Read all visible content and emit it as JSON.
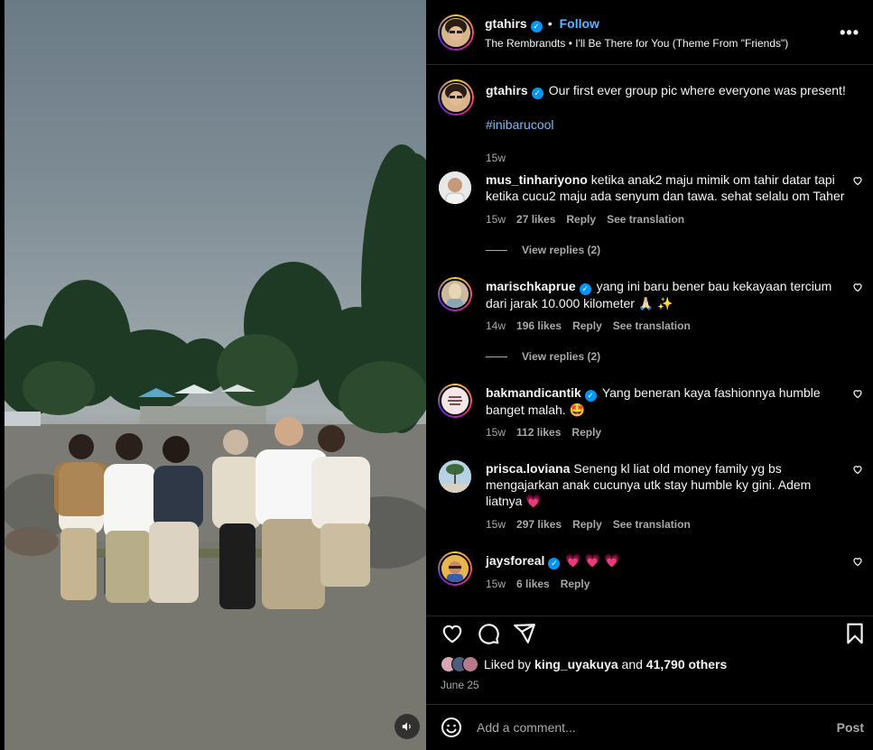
{
  "header": {
    "username": "gtahirs",
    "follow_label": "Follow",
    "separator": "•",
    "audio": "The Rembrandts • I'll Be There for You (Theme From \"Friends\")",
    "more": "•••"
  },
  "caption": {
    "username": "gtahirs",
    "text": "Our first ever group pic where everyone was present!",
    "hashtag": "#inibarucool",
    "time": "15w"
  },
  "comments": [
    {
      "username": "mus_tinhariyono",
      "verified": false,
      "text": "ketika anak2 maju mimik om tahir datar tapi ketika cucu2 maju ada senyum dan tawa. sehat selalu om Taher",
      "time": "15w",
      "likes": "27 likes",
      "reply": "Reply",
      "translation": "See translation",
      "view_replies": "View replies (2)"
    },
    {
      "username": "marischkaprue",
      "verified": true,
      "text": "yang ini baru bener bau kekayaan tercium dari jarak 10.000 kilometer 🙏🏻 ✨",
      "time": "14w",
      "likes": "196 likes",
      "reply": "Reply",
      "translation": "See translation",
      "view_replies": "View replies (2)"
    },
    {
      "username": "bakmandicantik",
      "verified": true,
      "text": "Yang beneran kaya fashionnya humble banget malah. 🤩",
      "time": "15w",
      "likes": "112 likes",
      "reply": "Reply"
    },
    {
      "username": "prisca.loviana",
      "verified": false,
      "text": "Seneng kl liat old money family yg bs mengajarkan anak cucunya utk stay humble ky gini. Adem liatnya 💗",
      "time": "15w",
      "likes": "297 likes",
      "reply": "Reply",
      "translation": "See translation"
    },
    {
      "username": "jaysforeal",
      "verified": true,
      "text": "💗 💗 💗",
      "time": "15w",
      "likes": "6 likes",
      "reply": "Reply"
    }
  ],
  "likes": {
    "prefix": "Liked by",
    "user": "king_uyakuya",
    "middle": "and",
    "count": "41,790 others"
  },
  "date": "June 25",
  "add_comment": {
    "placeholder": "Add a comment...",
    "post_label": "Post"
  },
  "colors": {
    "background": "#000000",
    "link_blue": "#5cb3ff",
    "verified_blue": "#0095f6",
    "muted": "#a8a8a8",
    "heart_red": "#ff3040"
  },
  "icons": [
    "speaker-icon",
    "more-icon",
    "heart-icon",
    "comment-icon",
    "share-icon",
    "bookmark-icon",
    "emoji-icon",
    "verified-icon"
  ]
}
